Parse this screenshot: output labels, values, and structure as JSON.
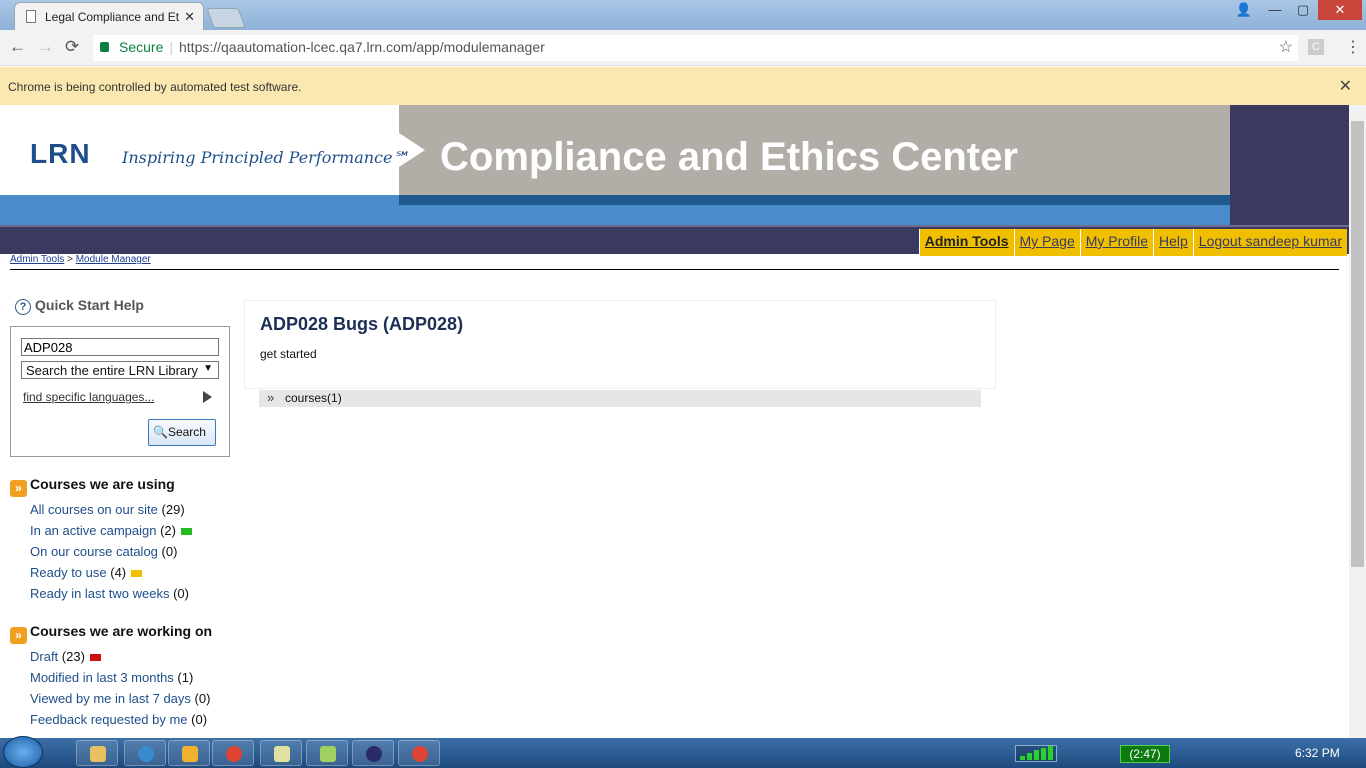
{
  "browser": {
    "tab_title": "Legal Compliance and Et",
    "tab_close": "✕",
    "secure_label": "Secure",
    "url": "https://qaautomation-lcec.qa7.lrn.com/app/modulemanager",
    "ext_label": "C",
    "infobar_text": "Chrome is being controlled by automated test software.",
    "infobar_close": "✕",
    "back": "←",
    "forward": "→",
    "reload": "⟳",
    "star": "☆",
    "menu": "⋮",
    "win_user": "👤",
    "win_min": "—",
    "win_max": "▢",
    "win_close": "✕"
  },
  "header": {
    "logo": "LRN",
    "tagline": "Inspiring Principled Performance℠",
    "title": "Compliance and Ethics Center"
  },
  "nav": {
    "admin_tools": "Admin Tools",
    "my_page": "My Page",
    "my_profile": "My Profile",
    "help": "Help",
    "logout": "Logout sandeep kumar"
  },
  "breadcrumb": {
    "admin_tools": "Admin Tools",
    "separator": ">",
    "module_manager": "Module Manager"
  },
  "sidebar": {
    "quick_start": "Quick Start Help",
    "search_value": "ADP028",
    "scope_select": "Search the entire LRN Library",
    "find_languages": "find specific languages...",
    "search_button": "Search",
    "using_title": "Courses we are using",
    "using_items": [
      {
        "label": "All courses on our site",
        "count": "(29)"
      },
      {
        "label": "In an active campaign",
        "count": "(2)",
        "color": "#22bb22"
      },
      {
        "label": "On our course catalog",
        "count": "(0)"
      },
      {
        "label": "Ready to use",
        "count": "(4)",
        "color": "#f0c000"
      },
      {
        "label": "Ready in last two weeks",
        "count": "(0)"
      }
    ],
    "working_title": "Courses we are working on",
    "working_items": [
      {
        "label": "Draft",
        "count": "(23)",
        "color": "#cc1111"
      },
      {
        "label": "Modified in last 3 months",
        "count": "(1)"
      },
      {
        "label": "Viewed by me in last 7 days",
        "count": "(0)"
      },
      {
        "label": "Feedback requested by me",
        "count": "(0)"
      }
    ]
  },
  "module": {
    "title": "ADP028 Bugs (ADP028)",
    "subtitle": "get started",
    "courses_label": "courses(1)"
  },
  "taskbar": {
    "battery": "(2:47)",
    "clock": "6:32 PM"
  },
  "colors": {
    "brand_navy": "#3a3a60",
    "brand_gold": "#f0c000",
    "link_blue": "#1e4f8a"
  }
}
